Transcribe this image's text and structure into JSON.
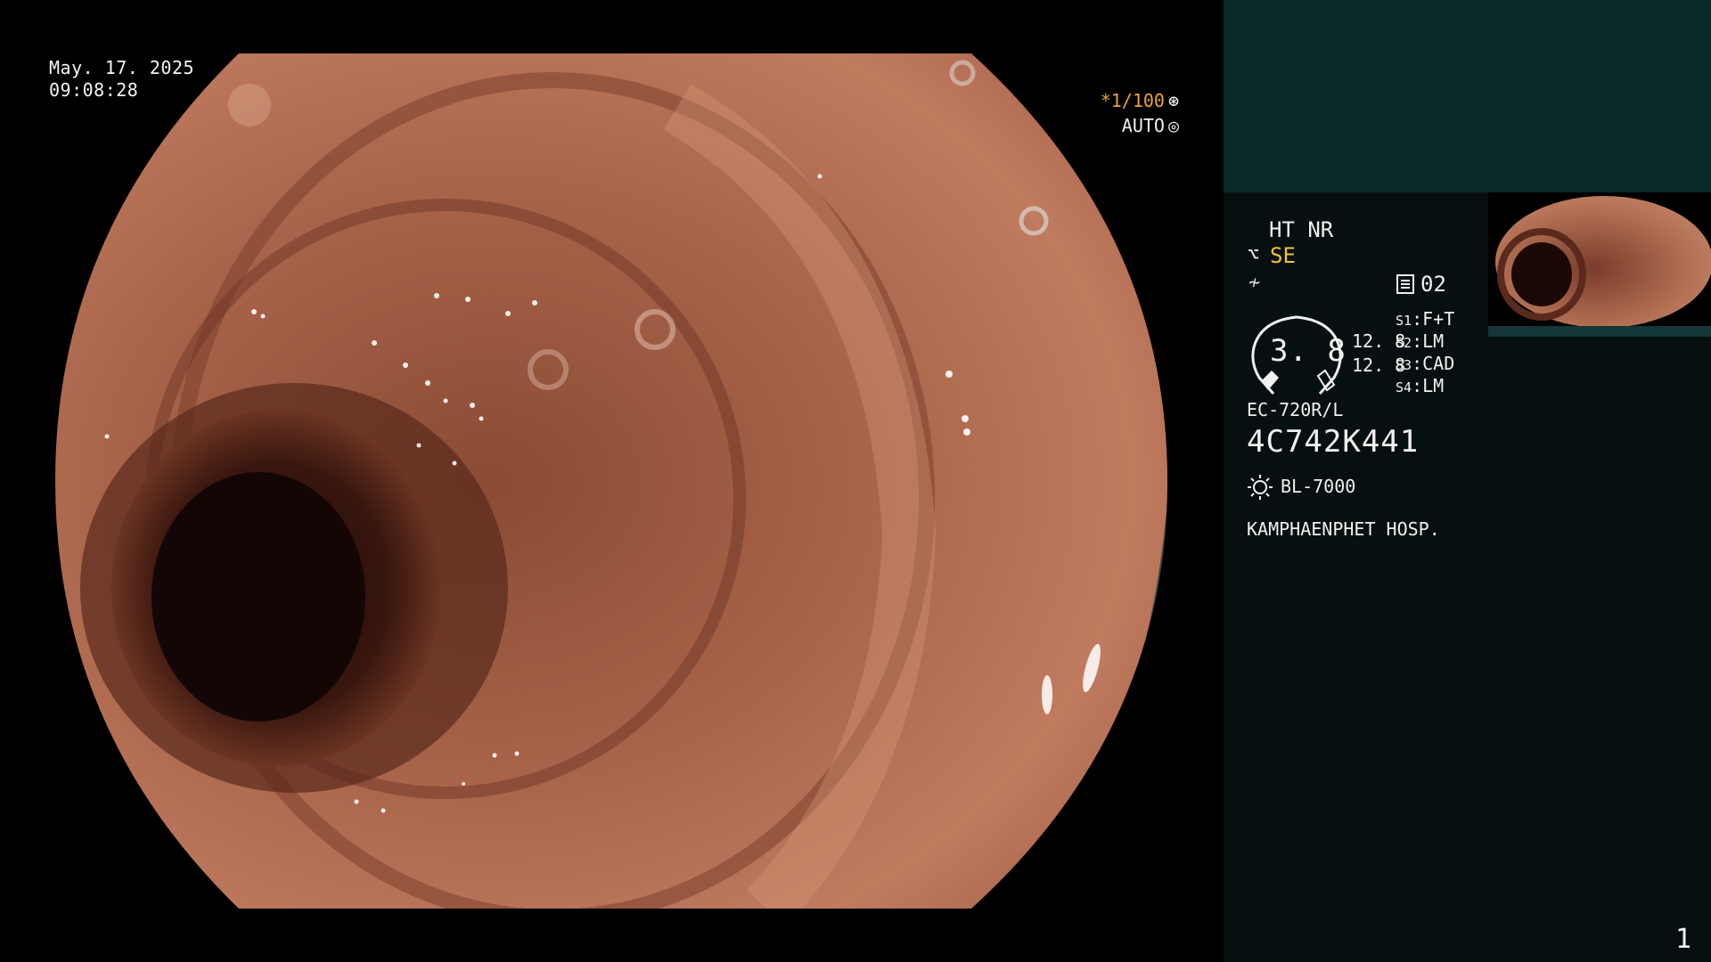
{
  "overlay": {
    "date": "May. 17. 2025",
    "time": "09:08:28",
    "shutter_speed": "*1/100",
    "iris_mode": "AUTO"
  },
  "panel": {
    "mode": "HT NR",
    "enhancement": "SE",
    "memory_label": "02",
    "gauge_value": "3. 8",
    "gauge_line_1": "12. 8",
    "gauge_line_2": "12. 8",
    "switches": [
      {
        "key": "S1",
        "value": "F+T"
      },
      {
        "key": "S2",
        "value": "LM"
      },
      {
        "key": "S3",
        "value": "CAD"
      },
      {
        "key": "S4",
        "value": "LM"
      }
    ],
    "scope_model": "EC-720R/L",
    "serial": "4C742K441",
    "light_source": "BL-7000",
    "hospital": "KAMPHAENPHET HOSP."
  },
  "page_number": "1",
  "icons": [
    "aperture-icon",
    "auto-iris-icon",
    "enhancement-icon",
    "color-mode-icon",
    "memory-icon",
    "light-source-icon"
  ],
  "colors": {
    "panel_bg": "#071010",
    "panel_top": "#0b2a2a",
    "accent_orange": "#e8a33a",
    "accent_yellow": "#f2c037"
  }
}
